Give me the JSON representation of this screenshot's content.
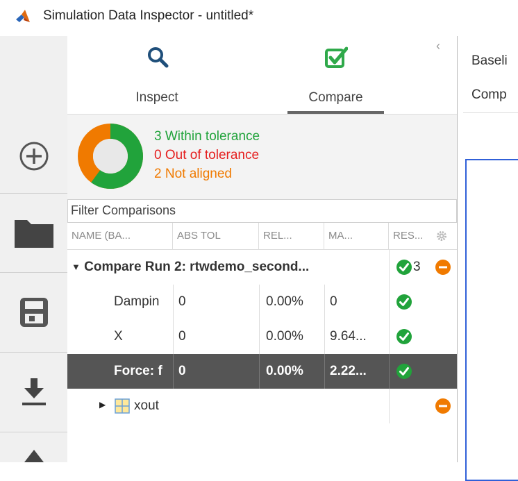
{
  "window": {
    "title": "Simulation Data Inspector - untitled*",
    "icon": "matlab-logo"
  },
  "left_toolbar": {
    "buttons": [
      {
        "name": "new",
        "icon": "plus-circle-icon"
      },
      {
        "name": "open",
        "icon": "folder-icon"
      },
      {
        "name": "save",
        "icon": "save-icon"
      },
      {
        "name": "import",
        "icon": "download-icon"
      },
      {
        "name": "export",
        "icon": "upload-icon"
      }
    ]
  },
  "tabs": {
    "inspect": {
      "label": "Inspect",
      "icon": "search-icon"
    },
    "compare": {
      "label": "Compare",
      "icon": "checkbox-icon",
      "active": true
    },
    "collapse_glyph": "‹"
  },
  "summary": {
    "within": {
      "count": 3,
      "text": "3 Within tolerance",
      "color": "#21a33b"
    },
    "out": {
      "count": 0,
      "text": "0 Out of tolerance",
      "color": "#e51e1e"
    },
    "not_aligned": {
      "count": 2,
      "text": "2 Not aligned",
      "color": "#f07a00"
    }
  },
  "filter": {
    "placeholder": "Filter Comparisons",
    "value": ""
  },
  "columns": [
    "NAME (BA...",
    "ABS TOL",
    "REL...",
    "MA...",
    "RES..."
  ],
  "comparison": {
    "group": {
      "label": "Compare Run 2: rtwdemo_second...",
      "result_count": "3"
    },
    "rows": [
      {
        "name": "Dampin",
        "abs_tol": "0",
        "rel_tol": "0.00%",
        "max": "0",
        "result": "ok",
        "selected": false
      },
      {
        "name": "X",
        "abs_tol": "0",
        "rel_tol": "0.00%",
        "max": "9.64...",
        "result": "ok",
        "selected": false
      },
      {
        "name": "Force: f",
        "abs_tol": "0",
        "rel_tol": "0.00%",
        "max": "2.22...",
        "result": "ok",
        "selected": true
      }
    ],
    "unaligned": {
      "label": "xout",
      "result": "not-aligned"
    }
  },
  "right_panel": {
    "baseline_label": "Baseli",
    "compare_label": "Comp"
  }
}
